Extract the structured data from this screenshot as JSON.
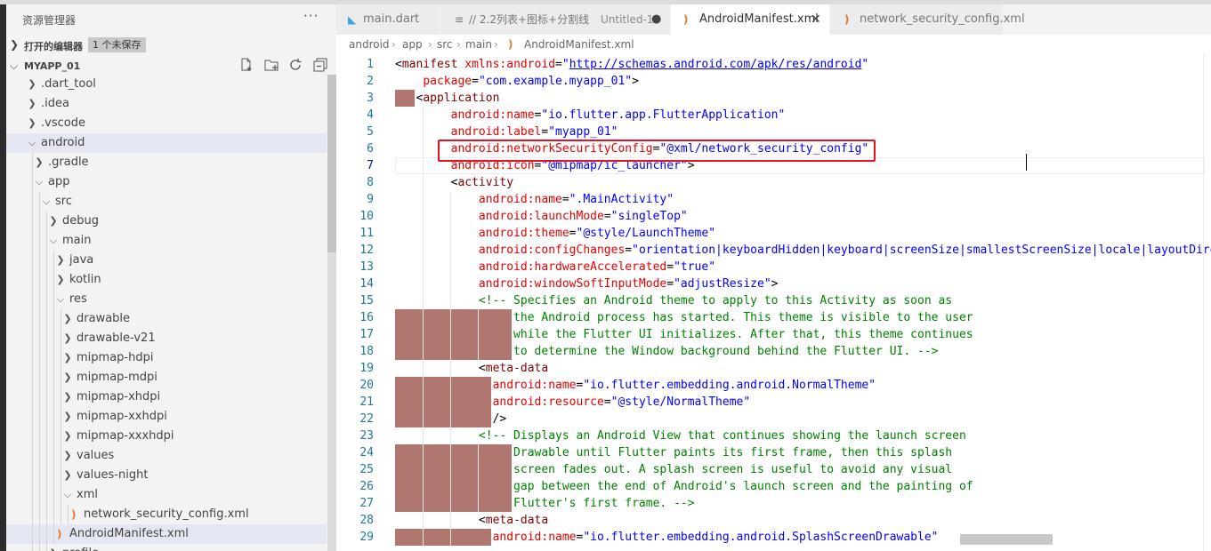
{
  "sidebar": {
    "title": "资源管理器",
    "more": "···",
    "open_editors": {
      "label": "打开的编辑器",
      "badge": "1 个未保存"
    },
    "project": {
      "label": "MYAPP_01",
      "actions": [
        {
          "name": "new-file-icon",
          "glyph": "🗋"
        },
        {
          "name": "new-folder-icon",
          "glyph": "🗀"
        },
        {
          "name": "refresh-icon",
          "glyph": "↻"
        },
        {
          "name": "collapse-all-icon",
          "glyph": "⊟"
        }
      ]
    },
    "tree": [
      {
        "label": ".dart_tool",
        "depth": 0,
        "state": "collapsed",
        "kind": "folder"
      },
      {
        "label": ".idea",
        "depth": 0,
        "state": "collapsed",
        "kind": "folder"
      },
      {
        "label": ".vscode",
        "depth": 0,
        "state": "collapsed",
        "kind": "folder"
      },
      {
        "label": "android",
        "depth": 0,
        "state": "expanded",
        "kind": "folder",
        "highlight": true
      },
      {
        "label": ".gradle",
        "depth": 1,
        "state": "collapsed",
        "kind": "folder"
      },
      {
        "label": "app",
        "depth": 1,
        "state": "expanded",
        "kind": "folder"
      },
      {
        "label": "src",
        "depth": 2,
        "state": "expanded",
        "kind": "folder"
      },
      {
        "label": "debug",
        "depth": 3,
        "state": "collapsed",
        "kind": "folder"
      },
      {
        "label": "main",
        "depth": 3,
        "state": "expanded",
        "kind": "folder"
      },
      {
        "label": "java",
        "depth": 4,
        "state": "collapsed",
        "kind": "folder"
      },
      {
        "label": "kotlin",
        "depth": 4,
        "state": "collapsed",
        "kind": "folder"
      },
      {
        "label": "res",
        "depth": 4,
        "state": "expanded",
        "kind": "folder"
      },
      {
        "label": "drawable",
        "depth": 5,
        "state": "collapsed",
        "kind": "folder"
      },
      {
        "label": "drawable-v21",
        "depth": 5,
        "state": "collapsed",
        "kind": "folder"
      },
      {
        "label": "mipmap-hdpi",
        "depth": 5,
        "state": "collapsed",
        "kind": "folder"
      },
      {
        "label": "mipmap-mdpi",
        "depth": 5,
        "state": "collapsed",
        "kind": "folder"
      },
      {
        "label": "mipmap-xhdpi",
        "depth": 5,
        "state": "collapsed",
        "kind": "folder"
      },
      {
        "label": "mipmap-xxhdpi",
        "depth": 5,
        "state": "collapsed",
        "kind": "folder"
      },
      {
        "label": "mipmap-xxxhdpi",
        "depth": 5,
        "state": "collapsed",
        "kind": "folder"
      },
      {
        "label": "values",
        "depth": 5,
        "state": "collapsed",
        "kind": "folder"
      },
      {
        "label": "values-night",
        "depth": 5,
        "state": "collapsed",
        "kind": "folder"
      },
      {
        "label": "xml",
        "depth": 5,
        "state": "expanded",
        "kind": "folder"
      },
      {
        "label": "network_security_config.xml",
        "depth": 6,
        "state": "none",
        "kind": "xml"
      },
      {
        "label": "AndroidManifest.xml",
        "depth": 4,
        "state": "none",
        "kind": "xml",
        "highlight": true
      },
      {
        "label": "profile",
        "depth": 3,
        "state": "collapsed",
        "kind": "folder"
      }
    ]
  },
  "tabs": [
    {
      "label": "main.dart",
      "icon": "dart-icon",
      "active": false
    },
    {
      "label": "// 2.2列表+图标+分割线",
      "sub": "Untitled-1",
      "icon": "text-file-icon",
      "dirty": true,
      "active": false
    },
    {
      "label": "AndroidManifest.xml",
      "icon": "rss-icon",
      "active": true,
      "close": "✕"
    },
    {
      "label": "network_security_config.xml",
      "icon": "rss-icon",
      "active": false
    }
  ],
  "breadcrumb": [
    "android",
    "app",
    "src",
    "main",
    "AndroidManifest.xml"
  ],
  "code": {
    "lines": [
      "<manifest xmlns:android=\"http://schemas.android.com/apk/res/android\"",
      "    package=\"com.example.myapp_01\">",
      "   <application",
      "        android:name=\"io.flutter.app.FlutterApplication\"",
      "        android:label=\"myapp_01\"",
      "        android:networkSecurityConfig=\"@xml/network_security_config\"",
      "        android:icon=\"@mipmap/ic_launcher\">",
      "        <activity",
      "            android:name=\".MainActivity\"",
      "            android:launchMode=\"singleTop\"",
      "            android:theme=\"@style/LaunchTheme\"",
      "            android:configChanges=\"orientation|keyboardHidden|keyboard|screenSize|smallestScreenSize|locale|layoutDire",
      "            android:hardwareAccelerated=\"true\"",
      "            android:windowSoftInputMode=\"adjustResize\">",
      "            <!-- Specifies an Android theme to apply to this Activity as soon as",
      "                 the Android process has started. This theme is visible to the user",
      "                 while the Flutter UI initializes. After that, this theme continues",
      "                 to determine the Window background behind the Flutter UI. -->",
      "            <meta-data",
      "              android:name=\"io.flutter.embedding.android.NormalTheme\"",
      "              android:resource=\"@style/NormalTheme\"",
      "              />",
      "            <!-- Displays an Android View that continues showing the launch screen",
      "                 Drawable until Flutter paints its first frame, then this splash",
      "                 screen fades out. A splash screen is useful to avoid any visual",
      "                 gap between the end of Android's launch screen and the painting of",
      "                 Flutter's first frame. -->",
      "            <meta-data",
      "              android:name=\"io.flutter.embedding.android.SplashScreenDrawable\""
    ],
    "first_line_number": 1,
    "current_line": 7,
    "highlighted_line": 6
  },
  "colors": {
    "tag": "#800000",
    "attribute": "#e50000",
    "value": "#0000ff",
    "comment": "#008000",
    "line_number": "#237893",
    "highlight_box": "#e81123",
    "indent_block": "#b07670"
  }
}
